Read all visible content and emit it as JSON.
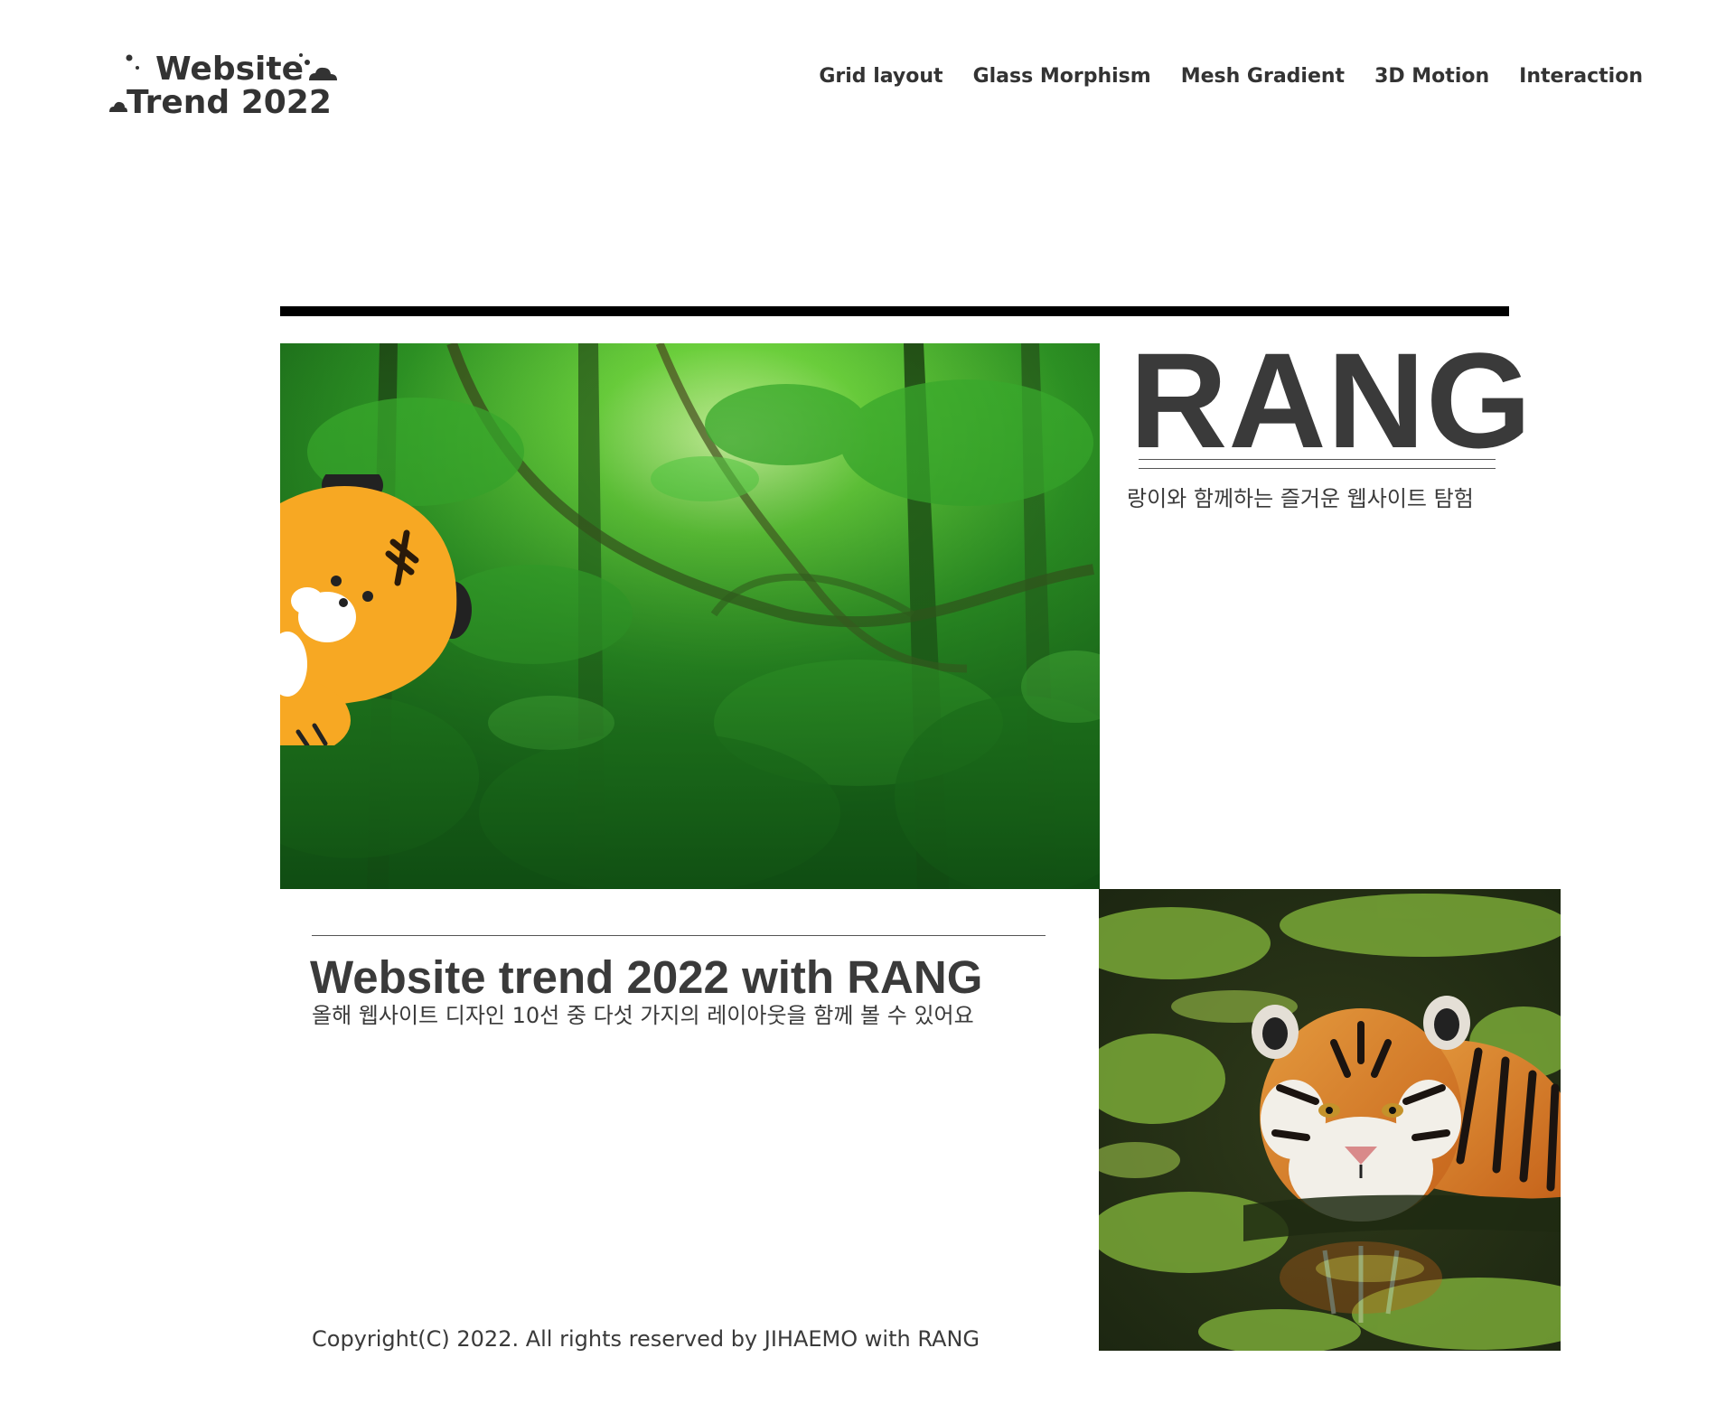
{
  "logo": {
    "line1": "Website",
    "line2": "Trend 2022",
    "icons": [
      "sparkle-dots-icon",
      "cloud-icon"
    ]
  },
  "nav": {
    "items": [
      {
        "label": "Grid layout"
      },
      {
        "label": "Glass Morphism"
      },
      {
        "label": "Mesh Gradient"
      },
      {
        "label": "3D Motion"
      },
      {
        "label": "Interaction"
      }
    ]
  },
  "hero": {
    "title": "RANG",
    "subtitle": "랑이와 함께하는 즐거운 웹사이트 탐험",
    "images": [
      "jungle-photo",
      "tiger-mascot",
      "swimming-tiger-photo"
    ]
  },
  "trend": {
    "title": "Website trend 2022 with RANG",
    "subtitle": "올해 웹사이트 디자인 10선 중 다섯 가지의 레이아웃을 함께 볼 수 있어요"
  },
  "footer": {
    "copyright": "Copyright(C) 2022. All rights reserved by JIHAEMO with RANG"
  },
  "colors": {
    "text": "#3a3a3a",
    "rule": "#000000",
    "jungle_green": "#2f8a1f",
    "mascot_orange": "#f7a823"
  }
}
